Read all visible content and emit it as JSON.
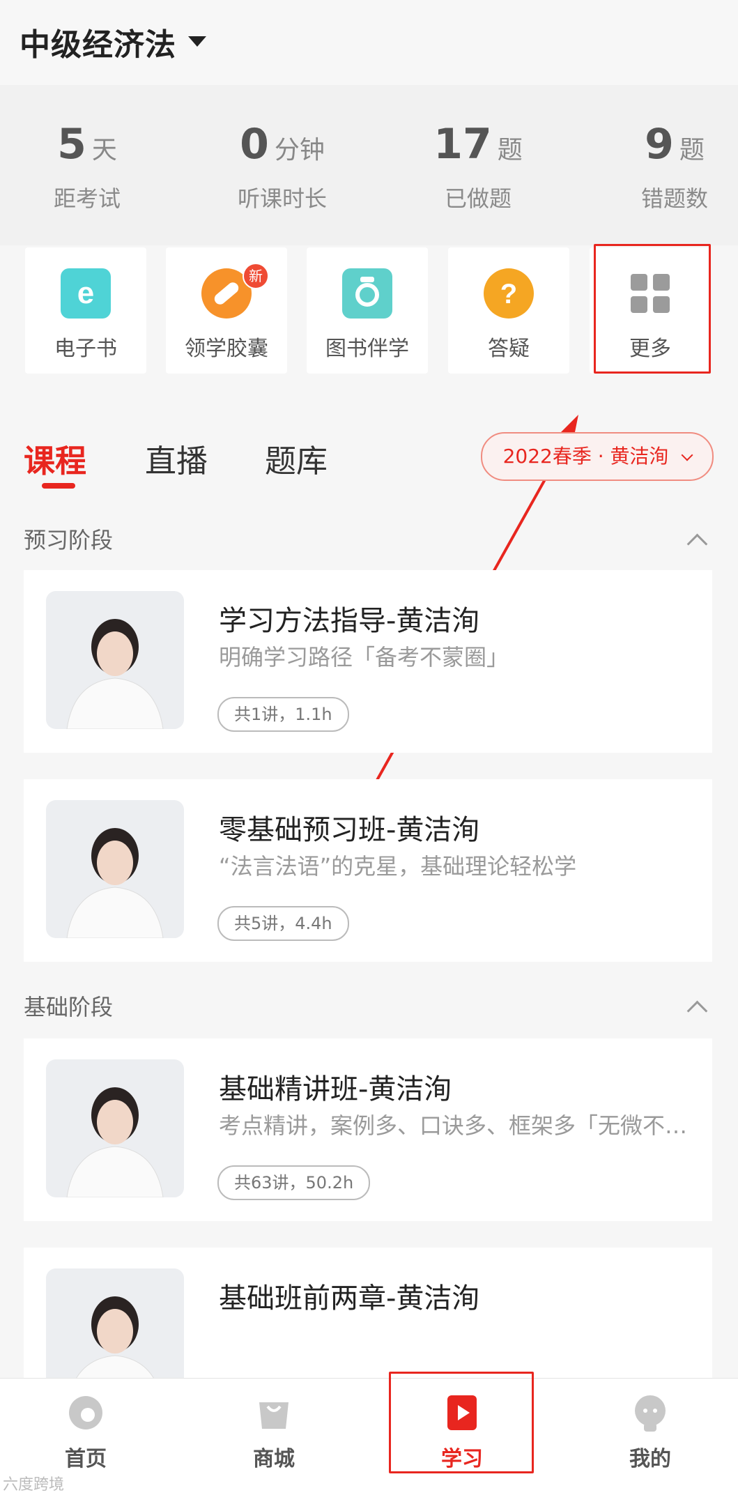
{
  "header": {
    "subject": "中级经济法"
  },
  "stats": [
    {
      "value": "5",
      "unit": "天",
      "label": "距考试"
    },
    {
      "value": "0",
      "unit": "分钟",
      "label": "听课时长"
    },
    {
      "value": "17",
      "unit": "题",
      "label": "已做题"
    },
    {
      "value": "9",
      "unit": "题",
      "label": "错题数"
    }
  ],
  "shortcuts": [
    {
      "label": "电子书",
      "icon": "ebook-icon"
    },
    {
      "label": "领学胶囊",
      "icon": "capsule-icon",
      "badge": "新"
    },
    {
      "label": "图书伴学",
      "icon": "camera-icon"
    },
    {
      "label": "答疑",
      "icon": "question-icon"
    },
    {
      "label": "更多",
      "icon": "grid-icon"
    }
  ],
  "tabs": [
    "课程",
    "直播",
    "题库"
  ],
  "season_selector": "2022春季 · 黄洁洵",
  "sections": [
    {
      "title": "预习阶段",
      "courses": [
        {
          "title": "学习方法指导-黄洁洵",
          "desc": "明确学习路径「备考不蒙圈」",
          "meta": "共1讲，1.1h"
        },
        {
          "title": "零基础预习班-黄洁洵",
          "desc": "“法言法语”的克星，基础理论轻松学",
          "meta": "共5讲，4.4h"
        }
      ]
    },
    {
      "title": "基础阶段",
      "courses": [
        {
          "title": "基础精讲班-黄洁洵",
          "desc": "考点精讲，案例多、口诀多、框架多「无微不…",
          "meta": "共63讲，50.2h"
        },
        {
          "title": "基础班前两章-黄洁洵",
          "desc": "",
          "meta": ""
        }
      ]
    }
  ],
  "bottom_nav": [
    {
      "label": "首页",
      "icon": "home-icon"
    },
    {
      "label": "商城",
      "icon": "shop-icon"
    },
    {
      "label": "学习",
      "icon": "study-icon",
      "active": true
    },
    {
      "label": "我的",
      "icon": "profile-icon"
    }
  ],
  "watermark": "六度跨境",
  "colors": {
    "accent": "#e8261f",
    "ebook": "#4fd3d6",
    "capsule": "#f7922a",
    "camera": "#5fd0cb",
    "question": "#f5a623"
  }
}
